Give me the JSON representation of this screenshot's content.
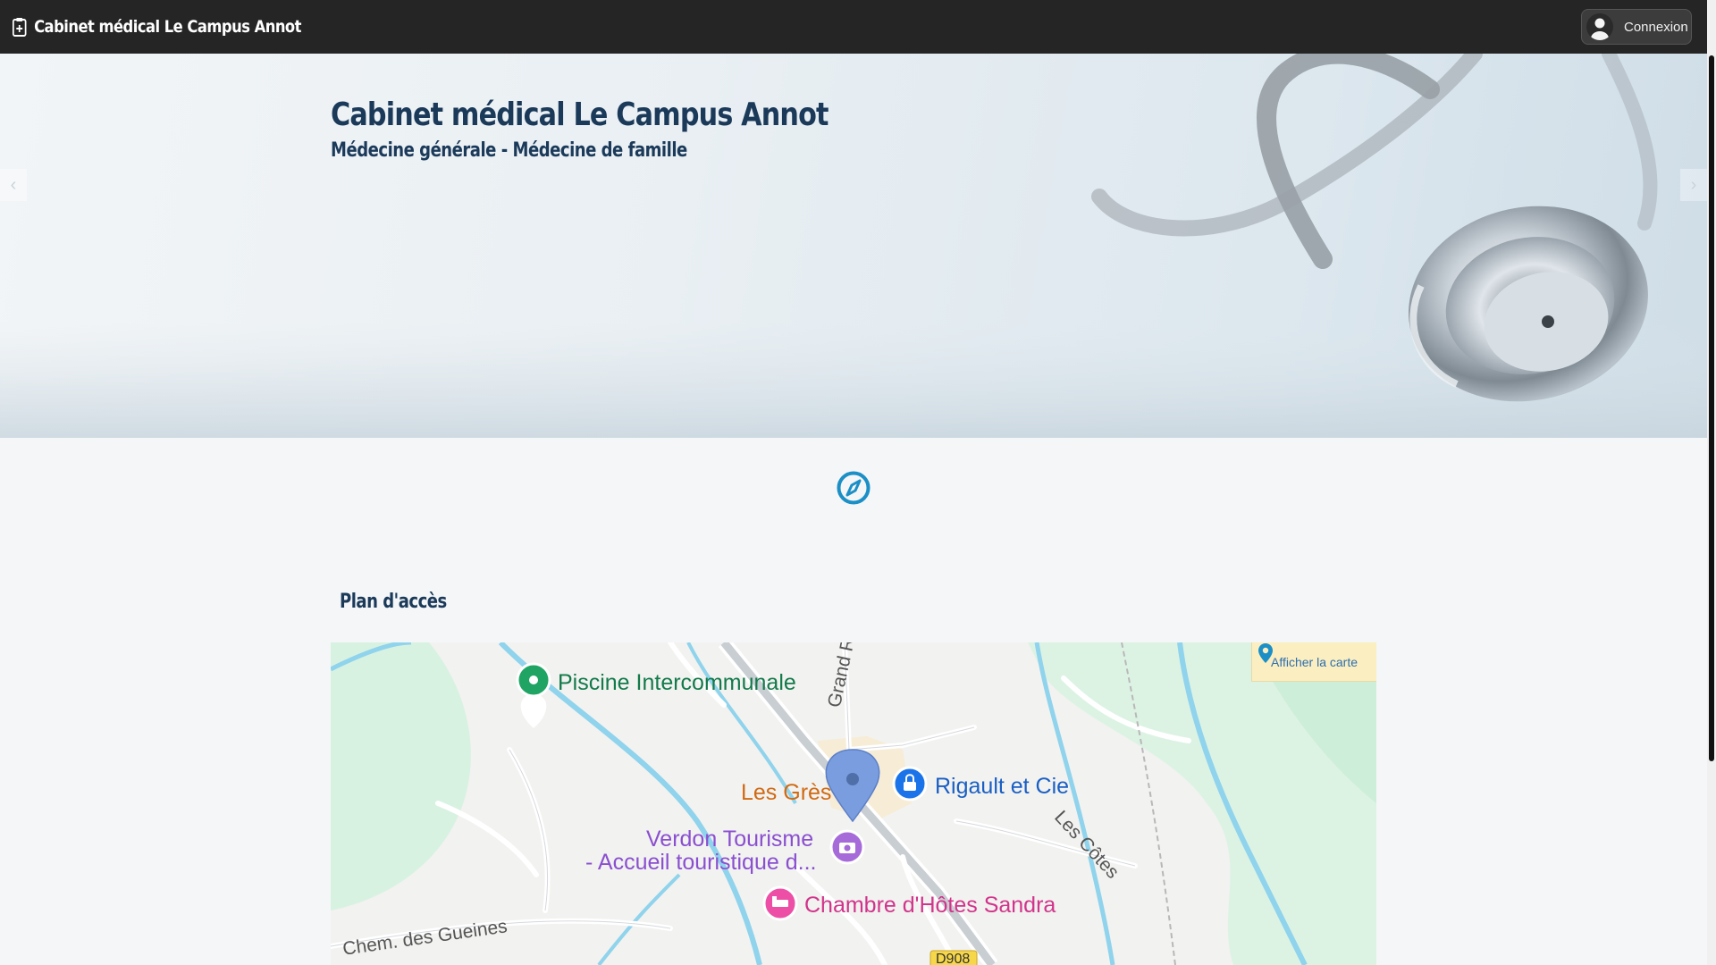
{
  "header": {
    "brand": "Cabinet médical Le Campus Annot",
    "login_label": "Connexion"
  },
  "hero": {
    "title": "Cabinet médical Le Campus Annot",
    "subtitle": "Médecine générale - Médecine de famille",
    "prev_arrow": "‹",
    "next_arrow": "›"
  },
  "access": {
    "title": "Plan d'accès"
  },
  "map": {
    "show_map_label": "Afficher la carte",
    "places": {
      "pool": "Piscine Intercommunale",
      "rigault": "Rigault et Cie",
      "gres": "Les Grès",
      "verdon_line1": "Verdon Tourisme",
      "verdon_line2": "- Accueil touristique d...",
      "chambre": "Chambre d'Hôtes Sandra",
      "grand_rue": "Grand Rue",
      "les_cotes": "Les Côtes",
      "gueines": "Chem. des Gueines",
      "road_d908": "D908"
    }
  },
  "colors": {
    "topbar": "#252525",
    "title": "#1b3a5a",
    "accent": "#1b8fc6",
    "show_map_bg": "#fbeec1"
  }
}
